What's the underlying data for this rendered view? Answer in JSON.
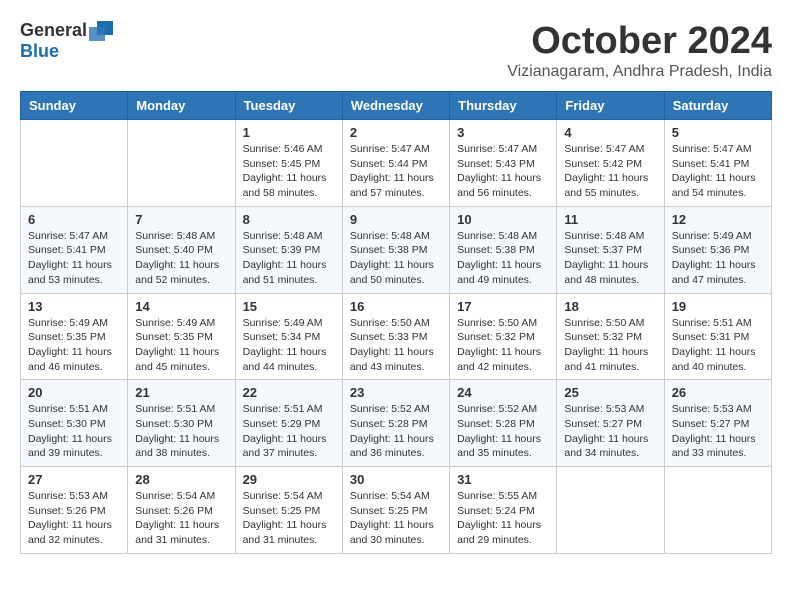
{
  "logo": {
    "general": "General",
    "blue": "Blue"
  },
  "title": "October 2024",
  "location": "Vizianagaram, Andhra Pradesh, India",
  "days_of_week": [
    "Sunday",
    "Monday",
    "Tuesday",
    "Wednesday",
    "Thursday",
    "Friday",
    "Saturday"
  ],
  "weeks": [
    [
      {
        "day": "",
        "sunrise": "",
        "sunset": "",
        "daylight": ""
      },
      {
        "day": "",
        "sunrise": "",
        "sunset": "",
        "daylight": ""
      },
      {
        "day": "1",
        "sunrise": "Sunrise: 5:46 AM",
        "sunset": "Sunset: 5:45 PM",
        "daylight": "Daylight: 11 hours and 58 minutes."
      },
      {
        "day": "2",
        "sunrise": "Sunrise: 5:47 AM",
        "sunset": "Sunset: 5:44 PM",
        "daylight": "Daylight: 11 hours and 57 minutes."
      },
      {
        "day": "3",
        "sunrise": "Sunrise: 5:47 AM",
        "sunset": "Sunset: 5:43 PM",
        "daylight": "Daylight: 11 hours and 56 minutes."
      },
      {
        "day": "4",
        "sunrise": "Sunrise: 5:47 AM",
        "sunset": "Sunset: 5:42 PM",
        "daylight": "Daylight: 11 hours and 55 minutes."
      },
      {
        "day": "5",
        "sunrise": "Sunrise: 5:47 AM",
        "sunset": "Sunset: 5:41 PM",
        "daylight": "Daylight: 11 hours and 54 minutes."
      }
    ],
    [
      {
        "day": "6",
        "sunrise": "Sunrise: 5:47 AM",
        "sunset": "Sunset: 5:41 PM",
        "daylight": "Daylight: 11 hours and 53 minutes."
      },
      {
        "day": "7",
        "sunrise": "Sunrise: 5:48 AM",
        "sunset": "Sunset: 5:40 PM",
        "daylight": "Daylight: 11 hours and 52 minutes."
      },
      {
        "day": "8",
        "sunrise": "Sunrise: 5:48 AM",
        "sunset": "Sunset: 5:39 PM",
        "daylight": "Daylight: 11 hours and 51 minutes."
      },
      {
        "day": "9",
        "sunrise": "Sunrise: 5:48 AM",
        "sunset": "Sunset: 5:38 PM",
        "daylight": "Daylight: 11 hours and 50 minutes."
      },
      {
        "day": "10",
        "sunrise": "Sunrise: 5:48 AM",
        "sunset": "Sunset: 5:38 PM",
        "daylight": "Daylight: 11 hours and 49 minutes."
      },
      {
        "day": "11",
        "sunrise": "Sunrise: 5:48 AM",
        "sunset": "Sunset: 5:37 PM",
        "daylight": "Daylight: 11 hours and 48 minutes."
      },
      {
        "day": "12",
        "sunrise": "Sunrise: 5:49 AM",
        "sunset": "Sunset: 5:36 PM",
        "daylight": "Daylight: 11 hours and 47 minutes."
      }
    ],
    [
      {
        "day": "13",
        "sunrise": "Sunrise: 5:49 AM",
        "sunset": "Sunset: 5:35 PM",
        "daylight": "Daylight: 11 hours and 46 minutes."
      },
      {
        "day": "14",
        "sunrise": "Sunrise: 5:49 AM",
        "sunset": "Sunset: 5:35 PM",
        "daylight": "Daylight: 11 hours and 45 minutes."
      },
      {
        "day": "15",
        "sunrise": "Sunrise: 5:49 AM",
        "sunset": "Sunset: 5:34 PM",
        "daylight": "Daylight: 11 hours and 44 minutes."
      },
      {
        "day": "16",
        "sunrise": "Sunrise: 5:50 AM",
        "sunset": "Sunset: 5:33 PM",
        "daylight": "Daylight: 11 hours and 43 minutes."
      },
      {
        "day": "17",
        "sunrise": "Sunrise: 5:50 AM",
        "sunset": "Sunset: 5:32 PM",
        "daylight": "Daylight: 11 hours and 42 minutes."
      },
      {
        "day": "18",
        "sunrise": "Sunrise: 5:50 AM",
        "sunset": "Sunset: 5:32 PM",
        "daylight": "Daylight: 11 hours and 41 minutes."
      },
      {
        "day": "19",
        "sunrise": "Sunrise: 5:51 AM",
        "sunset": "Sunset: 5:31 PM",
        "daylight": "Daylight: 11 hours and 40 minutes."
      }
    ],
    [
      {
        "day": "20",
        "sunrise": "Sunrise: 5:51 AM",
        "sunset": "Sunset: 5:30 PM",
        "daylight": "Daylight: 11 hours and 39 minutes."
      },
      {
        "day": "21",
        "sunrise": "Sunrise: 5:51 AM",
        "sunset": "Sunset: 5:30 PM",
        "daylight": "Daylight: 11 hours and 38 minutes."
      },
      {
        "day": "22",
        "sunrise": "Sunrise: 5:51 AM",
        "sunset": "Sunset: 5:29 PM",
        "daylight": "Daylight: 11 hours and 37 minutes."
      },
      {
        "day": "23",
        "sunrise": "Sunrise: 5:52 AM",
        "sunset": "Sunset: 5:28 PM",
        "daylight": "Daylight: 11 hours and 36 minutes."
      },
      {
        "day": "24",
        "sunrise": "Sunrise: 5:52 AM",
        "sunset": "Sunset: 5:28 PM",
        "daylight": "Daylight: 11 hours and 35 minutes."
      },
      {
        "day": "25",
        "sunrise": "Sunrise: 5:53 AM",
        "sunset": "Sunset: 5:27 PM",
        "daylight": "Daylight: 11 hours and 34 minutes."
      },
      {
        "day": "26",
        "sunrise": "Sunrise: 5:53 AM",
        "sunset": "Sunset: 5:27 PM",
        "daylight": "Daylight: 11 hours and 33 minutes."
      }
    ],
    [
      {
        "day": "27",
        "sunrise": "Sunrise: 5:53 AM",
        "sunset": "Sunset: 5:26 PM",
        "daylight": "Daylight: 11 hours and 32 minutes."
      },
      {
        "day": "28",
        "sunrise": "Sunrise: 5:54 AM",
        "sunset": "Sunset: 5:26 PM",
        "daylight": "Daylight: 11 hours and 31 minutes."
      },
      {
        "day": "29",
        "sunrise": "Sunrise: 5:54 AM",
        "sunset": "Sunset: 5:25 PM",
        "daylight": "Daylight: 11 hours and 31 minutes."
      },
      {
        "day": "30",
        "sunrise": "Sunrise: 5:54 AM",
        "sunset": "Sunset: 5:25 PM",
        "daylight": "Daylight: 11 hours and 30 minutes."
      },
      {
        "day": "31",
        "sunrise": "Sunrise: 5:55 AM",
        "sunset": "Sunset: 5:24 PM",
        "daylight": "Daylight: 11 hours and 29 minutes."
      },
      {
        "day": "",
        "sunrise": "",
        "sunset": "",
        "daylight": ""
      },
      {
        "day": "",
        "sunrise": "",
        "sunset": "",
        "daylight": ""
      }
    ]
  ]
}
